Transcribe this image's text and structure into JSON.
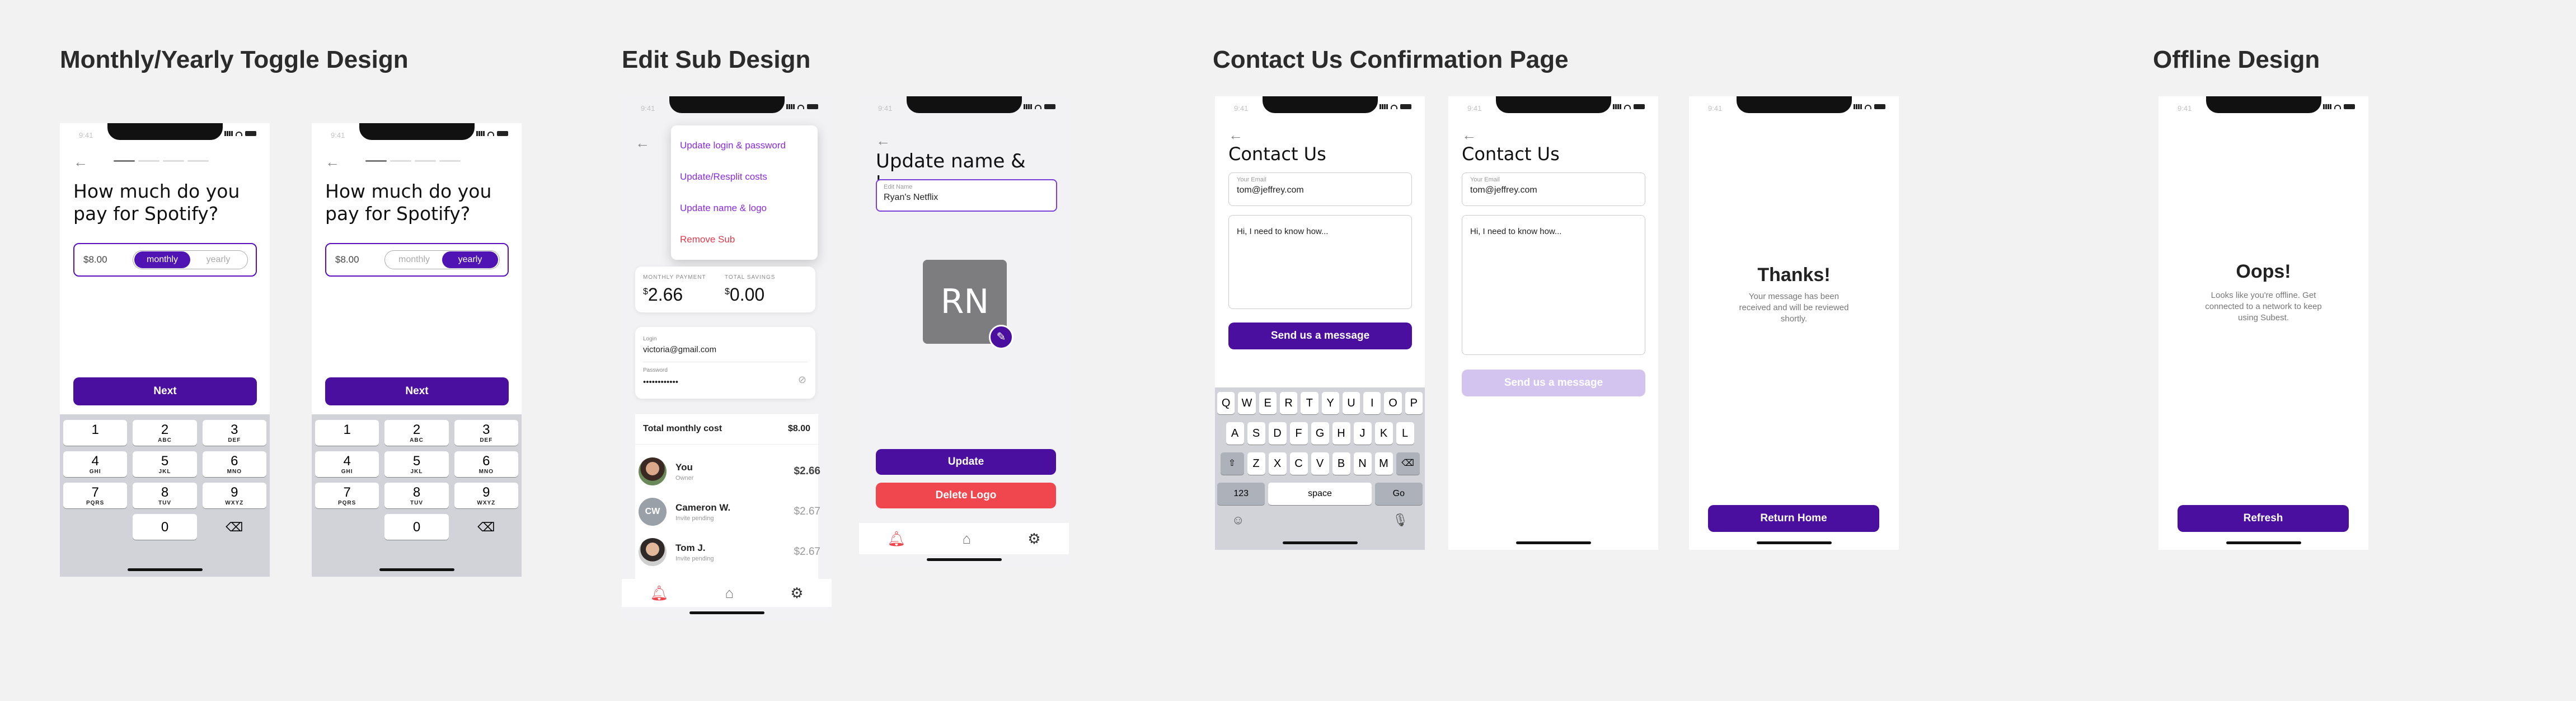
{
  "sections": {
    "toggle": "Monthly/Yearly Toggle Design",
    "editsub": "Edit Sub Design",
    "contact": "Contact Us Confirmation Page",
    "offline": "Offline Design"
  },
  "status_time": "9:41",
  "onboarding": {
    "question": "How much do you pay for Spotify?",
    "amount": "$8.00",
    "monthly": "monthly",
    "yearly": "yearly",
    "next": "Next"
  },
  "numpad": {
    "keys": [
      {
        "d": "1",
        "l": ""
      },
      {
        "d": "2",
        "l": "ABC"
      },
      {
        "d": "3",
        "l": "DEF"
      },
      {
        "d": "4",
        "l": "GHI"
      },
      {
        "d": "5",
        "l": "JKL"
      },
      {
        "d": "6",
        "l": "MNO"
      },
      {
        "d": "7",
        "l": "PQRS"
      },
      {
        "d": "8",
        "l": "TUV"
      },
      {
        "d": "9",
        "l": "WXYZ"
      }
    ],
    "zero": "0",
    "delete": "⌫"
  },
  "editsub": {
    "menu": [
      "Update login & password",
      "Update/Resplit costs",
      "Update name & logo",
      "Remove Sub"
    ],
    "monthly_payment_label": "MONTHLY PAYMENT",
    "monthly_payment_sym": "$",
    "monthly_payment_value": "2.66",
    "total_savings_label": "TOTAL SAVINGS",
    "total_savings_sym": "$",
    "total_savings_value": "0.00",
    "login_label": "Login",
    "login_value": "victoria@gmail.com",
    "password_label": "Password",
    "password_value": "••••••••••••",
    "total_cost_label": "Total monthly cost",
    "total_cost_value": "$8.00",
    "members": [
      {
        "name": "You",
        "sub": "Owner",
        "amount": "$2.66",
        "initials": ""
      },
      {
        "name": "Cameron W.",
        "sub": "Invite pending",
        "amount": "$2.67",
        "initials": "CW"
      },
      {
        "name": "Tom J.",
        "sub": "Invite pending",
        "amount": "$2.67",
        "initials": ""
      }
    ]
  },
  "updatename": {
    "title": "Update name & logo",
    "field_label": "Edit Name",
    "field_value": "Ryan's Netflix",
    "logo_initials": "RN",
    "update": "Update",
    "delete": "Delete Logo"
  },
  "contact": {
    "title": "Contact Us",
    "email_label": "Your Email",
    "email_value": "tom@jeffrey.com",
    "message": "Hi, I need to know how...",
    "send": "Send us a message"
  },
  "keyboard": {
    "row1": [
      "Q",
      "W",
      "E",
      "R",
      "T",
      "Y",
      "U",
      "I",
      "O",
      "P"
    ],
    "row2": [
      "A",
      "S",
      "D",
      "F",
      "G",
      "H",
      "J",
      "K",
      "L"
    ],
    "row3": [
      "Z",
      "X",
      "C",
      "V",
      "B",
      "N",
      "M"
    ],
    "shift": "⇧",
    "backspace": "⌫",
    "num": "123",
    "space": "space",
    "go": "Go",
    "emoji": "☺",
    "mic": "🎙"
  },
  "thanks": {
    "title": "Thanks!",
    "body": "Your message has been received and will be reviewed shortly.",
    "button": "Return Home"
  },
  "offline": {
    "title": "Oops!",
    "body": "Looks like you're offline. Get connected to a network to keep using Subest.",
    "button": "Refresh"
  },
  "tab_icons": [
    "bell-icon",
    "home-icon",
    "gear-icon"
  ],
  "colors": {
    "accent": "#4b0f9f",
    "danger": "#f0474f",
    "link": "#8a2be2"
  }
}
